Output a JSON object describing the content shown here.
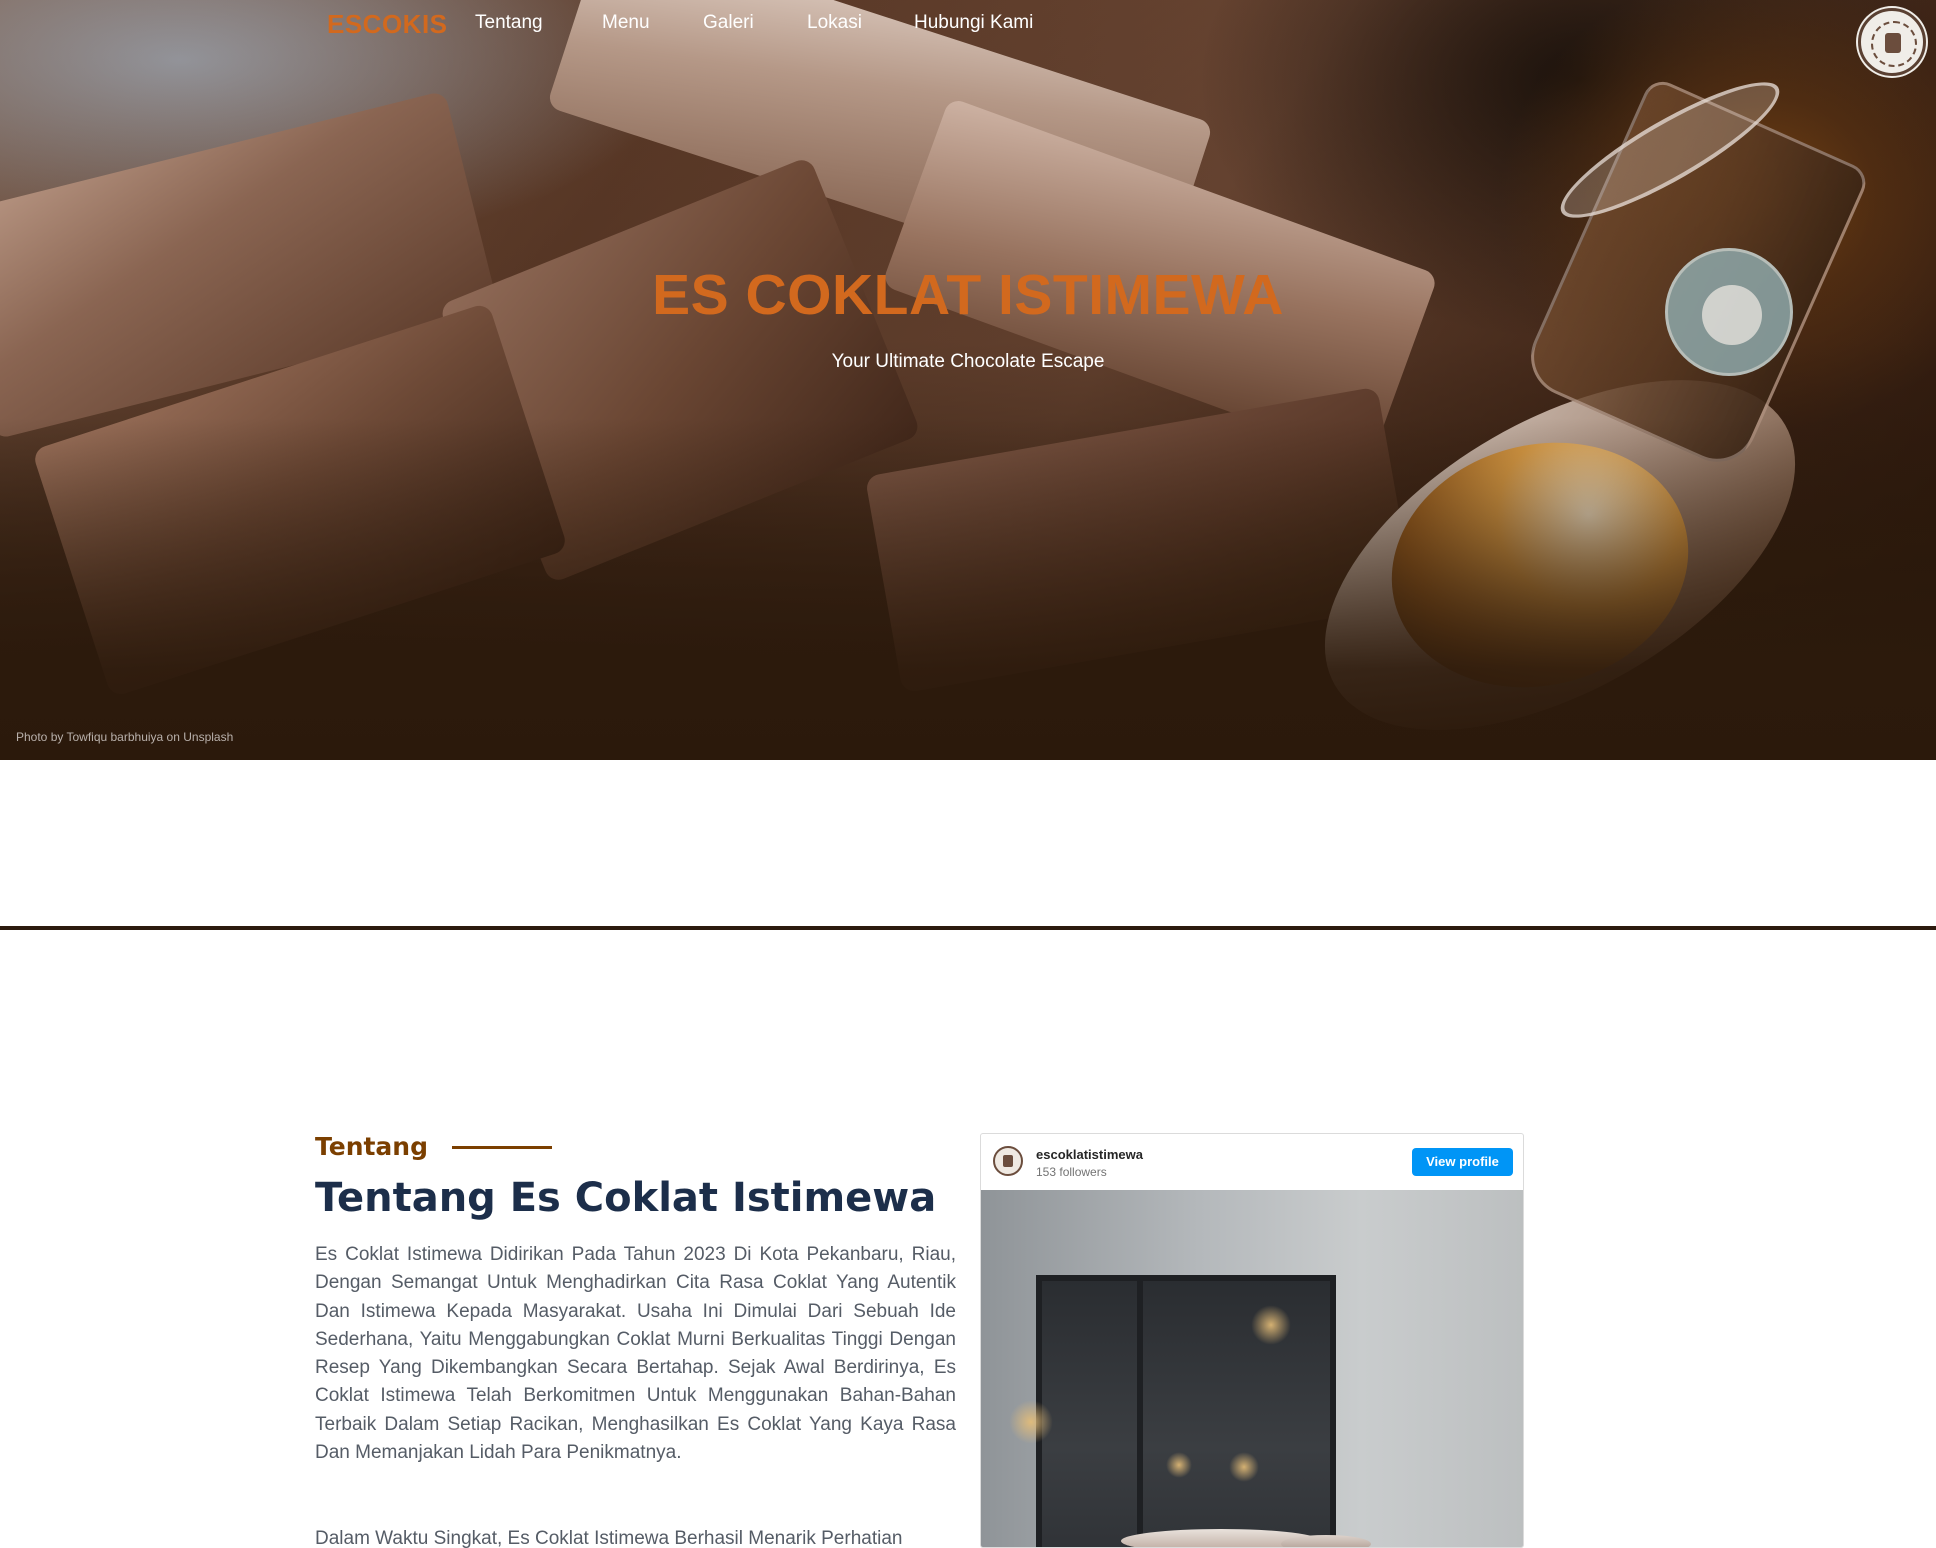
{
  "nav": {
    "brand": "ESCOKIS",
    "links": [
      "Tentang",
      "Menu",
      "Galeri",
      "Lokasi",
      "Hubungi Kami"
    ],
    "logo_icon": "es-coklat-istimewa-logo"
  },
  "hero": {
    "title": "ES COKLAT ISTIMEWA",
    "subtitle": "Your Ultimate Chocolate Escape",
    "credit": "Photo by Towfiqu barbhuiya on Unsplash"
  },
  "about": {
    "eyebrow": "Tentang",
    "title": "Tentang Es Coklat Istimewa",
    "paragraph1": "Es Coklat Istimewa Didirikan Pada Tahun 2023 Di Kota Pekanbaru, Riau, Dengan Semangat Untuk Menghadirkan Cita Rasa Coklat Yang Autentik Dan Istimewa Kepada Masyarakat. Usaha Ini Dimulai Dari Sebuah Ide Sederhana, Yaitu Menggabungkan Coklat Murni Berkualitas Tinggi Dengan Resep Yang Dikembangkan Secara Bertahap. Sejak Awal Berdirinya, Es Coklat Istimewa Telah Berkomitmen Untuk Menggunakan Bahan-Bahan Terbaik Dalam Setiap Racikan, Menghasilkan Es Coklat Yang Kaya Rasa Dan Memanjakan Lidah Para Penikmatnya.",
    "paragraph2": "Dalam Waktu Singkat, Es Coklat Istimewa Berhasil Menarik Perhatian"
  },
  "instagram": {
    "username": "escoklatistimewa",
    "followers": "153 followers",
    "button": "View profile"
  },
  "colors": {
    "brand": "#d2691e",
    "eyebrow": "#7b3f00",
    "heading": "#1c2e4a",
    "body_text": "#555c66",
    "ig_button": "#0095f6",
    "divider": "#2c1a0e"
  }
}
